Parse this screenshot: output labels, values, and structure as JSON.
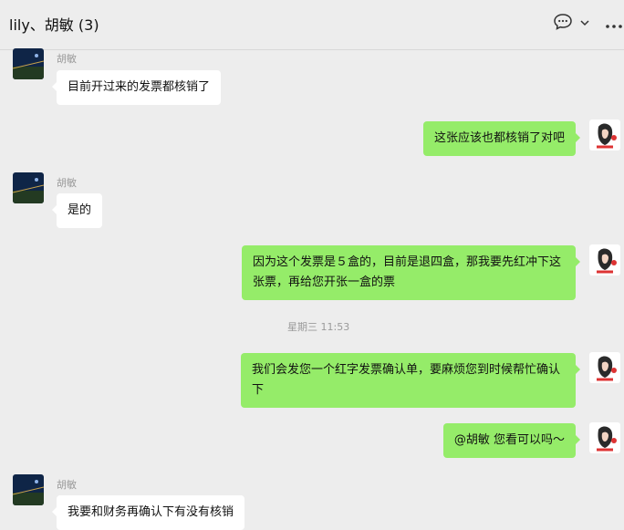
{
  "header": {
    "title": "lily、胡敏 (3)"
  },
  "messages": [
    {
      "sender": "胡敏",
      "text": "目前开过来的发票都核销了"
    },
    {
      "text": "这张应该也都核销了对吧"
    },
    {
      "sender": "胡敏",
      "text": "是的"
    },
    {
      "text": "因为这个发票是５盒的，目前是退四盒，那我要先红冲下这张票，再给您开张一盒的票"
    },
    {
      "timestamp": "星期三 11:53"
    },
    {
      "text": "我们会发您一个红字发票确认单，要麻烦您到时候帮忙确认下"
    },
    {
      "text": "@胡敏 您看可以吗～"
    },
    {
      "sender": "胡敏",
      "text": "我要和财务再确认下有没有核销"
    }
  ],
  "colors": {
    "background": "#ededed",
    "outgoing_bubble": "#95ec69",
    "incoming_bubble": "#ffffff"
  },
  "icons": [
    "chat-bubble-icon",
    "chevron-down-icon",
    "more-icon"
  ]
}
